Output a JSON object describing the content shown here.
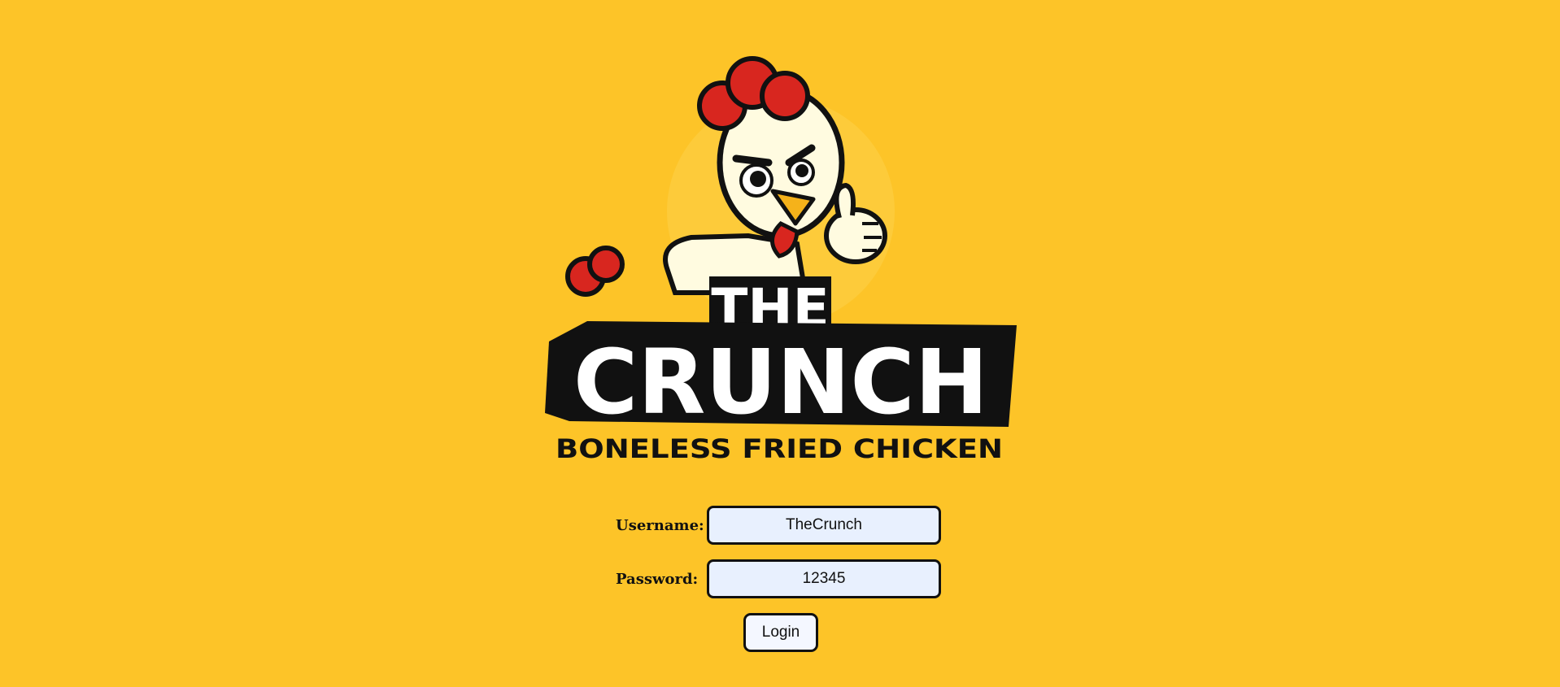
{
  "logo": {
    "line1": "THE",
    "line2": "CRUNCH",
    "tagline": "BONELESS FRIED CHICKEN"
  },
  "form": {
    "username_label": "Username:",
    "username_value": "TheCrunch",
    "password_label": "Password:",
    "password_value": "12345",
    "login_label": "Login"
  },
  "colors": {
    "background": "#fdc428",
    "comb_red": "#d8261f",
    "chicken_body": "#fffbe0",
    "beak": "#f5b21a",
    "outline": "#111111"
  }
}
